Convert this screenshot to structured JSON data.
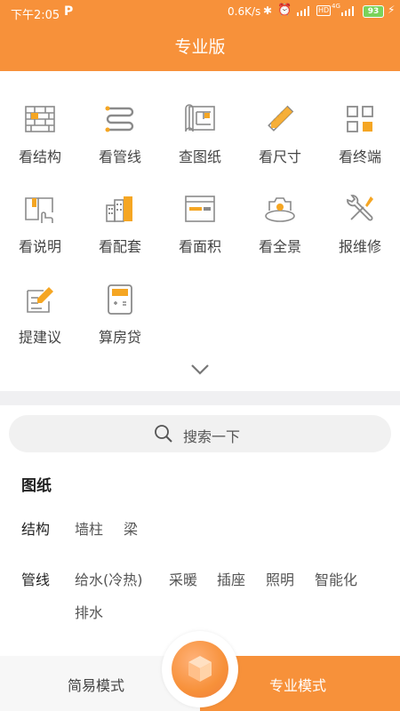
{
  "status_bar": {
    "time": "下午2:05",
    "p_icon": "P",
    "speed": "0.6K/s",
    "hd": "HD",
    "network": "4G",
    "battery": "93"
  },
  "header": {
    "title": "专业版"
  },
  "features": [
    {
      "label": "看结构",
      "icon": "brick-wall-icon"
    },
    {
      "label": "看管线",
      "icon": "pipe-icon"
    },
    {
      "label": "查图纸",
      "icon": "blueprint-icon"
    },
    {
      "label": "看尺寸",
      "icon": "ruler-pencil-icon"
    },
    {
      "label": "看终端",
      "icon": "grid-terminal-icon"
    },
    {
      "label": "看说明",
      "icon": "manual-book-icon"
    },
    {
      "label": "看配套",
      "icon": "buildings-icon"
    },
    {
      "label": "看面积",
      "icon": "area-window-icon"
    },
    {
      "label": "看全景",
      "icon": "panorama-camera-icon"
    },
    {
      "label": "报维修",
      "icon": "wrench-screwdriver-icon"
    },
    {
      "label": "提建议",
      "icon": "suggestion-pencil-icon"
    },
    {
      "label": "算房贷",
      "icon": "calculator-icon"
    }
  ],
  "expand_icon": "chevron-down-icon",
  "search": {
    "placeholder": "搜索一下"
  },
  "drawings": {
    "title": "图纸",
    "structure": {
      "label": "结构",
      "tags": [
        "墙柱",
        "梁"
      ]
    },
    "pipes": {
      "label": "管线",
      "tags": [
        "给水(冷热)",
        "采暖",
        "插座",
        "照明",
        "智能化",
        "排水"
      ]
    }
  },
  "tabbar": {
    "simple": "简易模式",
    "pro": "专业模式",
    "center_icon": "cube-icon"
  },
  "colors": {
    "accent": "#f7913a",
    "icon_orange": "#f5a623",
    "icon_gray": "#8a8a8a"
  }
}
